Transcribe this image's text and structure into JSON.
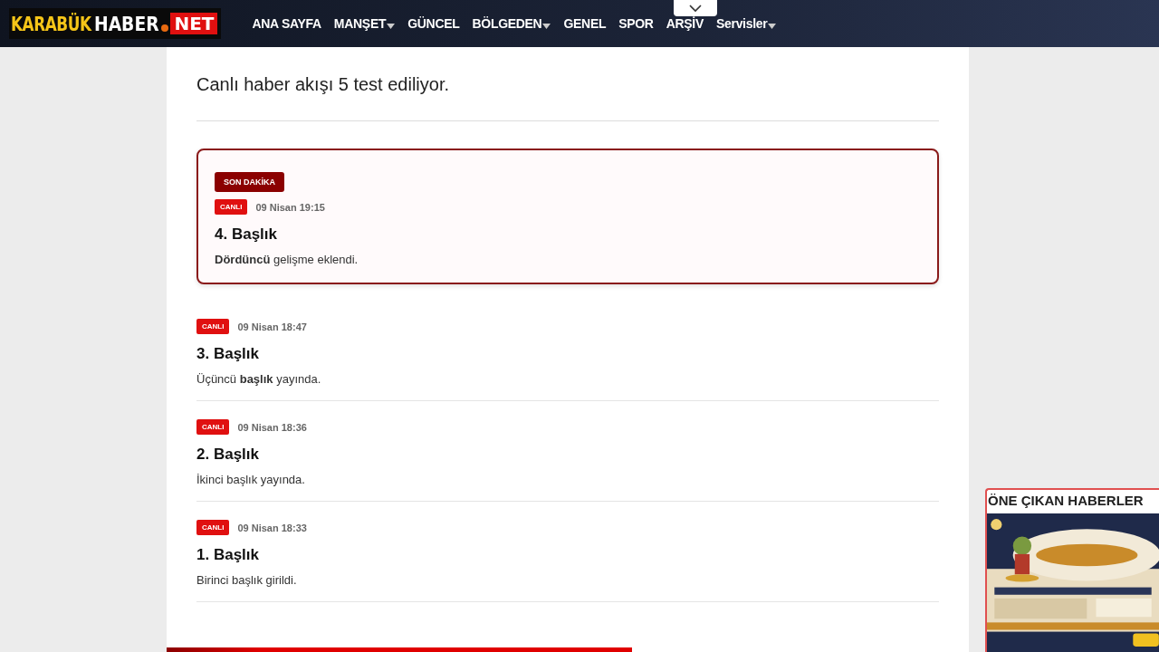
{
  "nav": {
    "logo": {
      "part_1": "KARABÜK",
      "part_2": "HABER",
      "part_3": "NET"
    },
    "items": [
      {
        "label": "ANA SAYFA",
        "dropdown": false
      },
      {
        "label": "MANŞET",
        "dropdown": true
      },
      {
        "label": "GÜNCEL",
        "dropdown": false
      },
      {
        "label": "BÖLGEDEN",
        "dropdown": true
      },
      {
        "label": "GENEL",
        "dropdown": false
      },
      {
        "label": "SPOR",
        "dropdown": false
      },
      {
        "label": "ARŞİV",
        "dropdown": false
      },
      {
        "label": "Servisler",
        "dropdown": true
      }
    ]
  },
  "article": {
    "title": "Canlı haber akışı 5 test ediliyor.",
    "entries": [
      {
        "highlighted": true,
        "flag": "SON DAKİKA",
        "badge": "CANLI",
        "time": "09 Nisan 19:15",
        "heading": "4. Başlık",
        "body": "**Dördüncü** gelişme eklendi."
      },
      {
        "highlighted": false,
        "badge": "CANLI",
        "time": "09 Nisan 18:47",
        "heading": "3. Başlık",
        "body": "Üçüncü **başlık** yayında."
      },
      {
        "highlighted": false,
        "badge": "CANLI",
        "time": "09 Nisan 18:36",
        "heading": "2. Başlık",
        "body": "İkinci başlık yayında."
      },
      {
        "highlighted": false,
        "badge": "CANLI",
        "time": "09 Nisan 18:33",
        "heading": "1. Başlık",
        "body": "Birinci başlık girildi."
      }
    ]
  },
  "reading_progress": {
    "level": 0.58
  },
  "featured": {
    "title": "ÖNE ÇIKAN HABERLER"
  }
}
